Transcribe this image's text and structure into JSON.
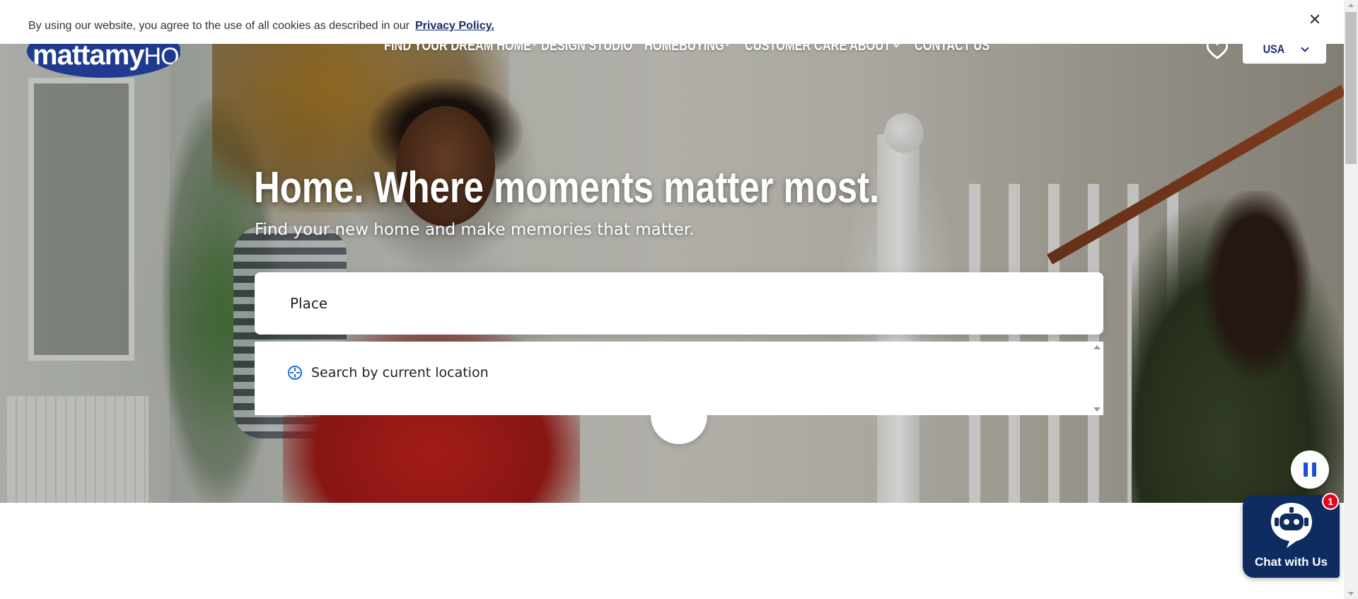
{
  "cookie": {
    "text": "By using our website, you agree to the use of all cookies as described in our",
    "link": "Privacy Policy.",
    "close": "✕"
  },
  "logo": {
    "brand_bold": "mattamy",
    "brand_thin": "HOMES"
  },
  "nav": {
    "items": [
      {
        "label": "FIND YOUR DREAM HOME",
        "has_dropdown": true
      },
      {
        "label": "DESIGN STUDIO",
        "has_dropdown": false
      },
      {
        "label": "HOMEBUYING",
        "has_dropdown": true
      },
      {
        "label": "CUSTOMER CARE",
        "has_dropdown": false
      },
      {
        "label": "ABOUT",
        "has_dropdown": true
      },
      {
        "label": "CONTACT US",
        "has_dropdown": false
      }
    ],
    "favorites_icon": "heart-icon",
    "country": "USA"
  },
  "hero": {
    "headline": "Home. Where moments matter most.",
    "subhead": "Find your new home and make memories that matter."
  },
  "search": {
    "value": "Place",
    "dropdown_option": "Search by current location",
    "dropdown_icon": "crosshair-icon"
  },
  "controls": {
    "pause_icon": "pause-icon",
    "scroll_icon": "chevron-down-icon"
  },
  "chat": {
    "label": "Chat with Us",
    "badge": "1",
    "icon": "chatbot-icon"
  },
  "colors": {
    "brand_navy": "#1a2c6b",
    "logo_blue": "#1f3b8f",
    "chat_bg": "#0f2c61",
    "accent_blue": "#1f4fd6",
    "badge_red": "#e8001c"
  }
}
